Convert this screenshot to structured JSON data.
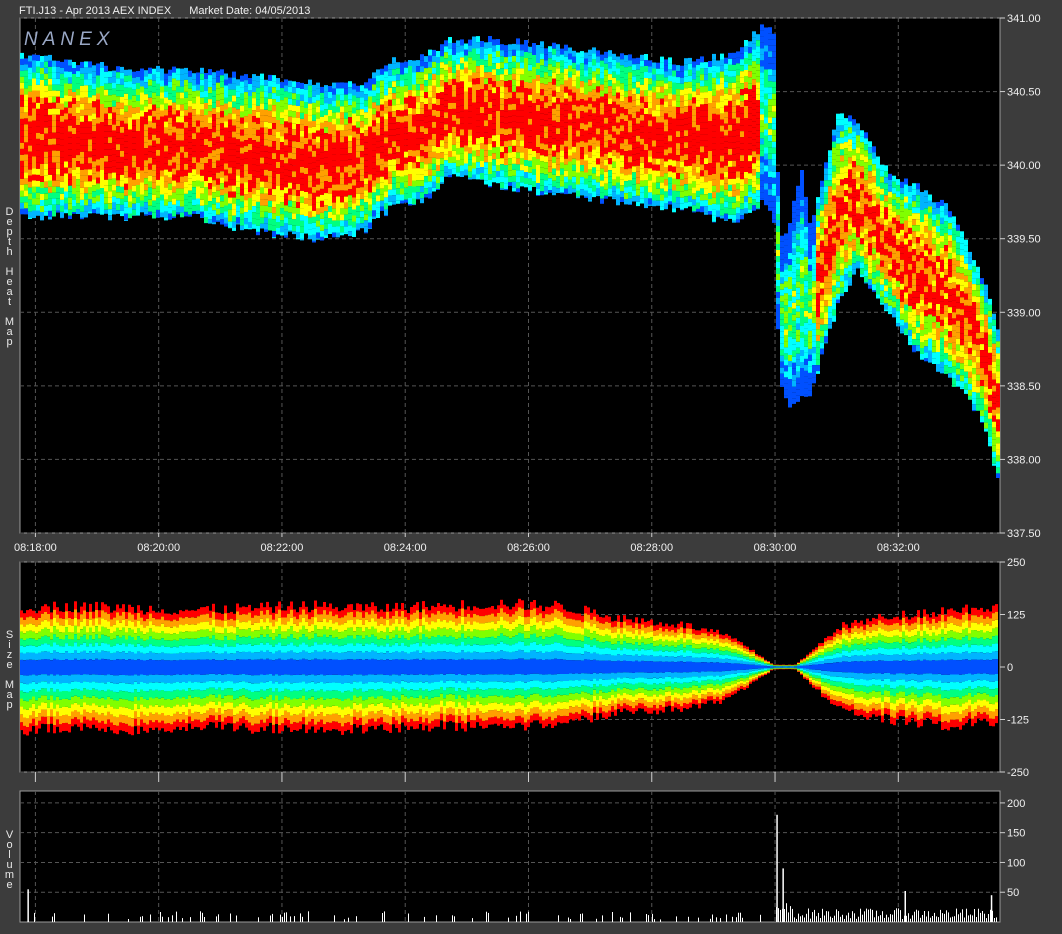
{
  "header": {
    "symbol_desc": "FTI.J13 - Apr 2013 AEX INDEX",
    "market_date_label": "Market Date: 04/05/2013"
  },
  "logo_text": "NANEX",
  "colors": {
    "background": "#3c3c3c",
    "plot_bg": "#000000",
    "grid": "#555555",
    "heat_scale": [
      "#0050ff",
      "#00b4ff",
      "#00ffff",
      "#00ff80",
      "#80ff00",
      "#ffff00",
      "#ffa000",
      "#ff0000"
    ],
    "volume_bar": "#ffffff"
  },
  "chart_data": [
    {
      "type": "heatmap",
      "name": "depth-heat-map",
      "panel_label": "Depth Heat Map",
      "x_ticks": [
        "08:18:00",
        "08:20:00",
        "08:22:00",
        "08:24:00",
        "08:26:00",
        "08:28:00",
        "08:30:00",
        "08:32:00"
      ],
      "y_ticks": [
        "341.00",
        "340.50",
        "340.00",
        "339.50",
        "339.00",
        "338.50",
        "338.00",
        "337.50"
      ],
      "ylim": [
        337.5,
        341.0
      ],
      "xlim_minutes": [
        17.75,
        33.65
      ],
      "grid": true,
      "bands": [
        {
          "t": 17.75,
          "low": 339.65,
          "high": 340.75
        },
        {
          "t": 18.5,
          "low": 339.65,
          "high": 340.7
        },
        {
          "t": 19.5,
          "low": 339.65,
          "high": 340.65
        },
        {
          "t": 20.5,
          "low": 339.65,
          "high": 340.65
        },
        {
          "t": 21.5,
          "low": 339.55,
          "high": 340.6
        },
        {
          "t": 22.5,
          "low": 339.5,
          "high": 340.55
        },
        {
          "t": 23.3,
          "low": 339.55,
          "high": 340.55
        },
        {
          "t": 23.7,
          "low": 339.7,
          "high": 340.7
        },
        {
          "t": 24.3,
          "low": 339.75,
          "high": 340.75
        },
        {
          "t": 24.7,
          "low": 339.95,
          "high": 340.85
        },
        {
          "t": 25.5,
          "low": 339.85,
          "high": 340.85
        },
        {
          "t": 26.5,
          "low": 339.8,
          "high": 340.8
        },
        {
          "t": 27.5,
          "low": 339.75,
          "high": 340.75
        },
        {
          "t": 28.5,
          "low": 339.7,
          "high": 340.7
        },
        {
          "t": 29.3,
          "low": 339.6,
          "high": 340.75
        },
        {
          "t": 29.8,
          "low": 339.75,
          "high": 340.95
        },
        {
          "t": 29.95,
          "low": 339.6,
          "high": 340.9
        },
        {
          "t": 30.05,
          "low": 338.5,
          "high": 339.5
        },
        {
          "t": 30.2,
          "low": 338.35,
          "high": 339.6
        },
        {
          "t": 30.4,
          "low": 338.45,
          "high": 339.95
        },
        {
          "t": 30.55,
          "low": 338.45,
          "high": 339.6
        },
        {
          "t": 31.0,
          "low": 339.05,
          "high": 340.35
        },
        {
          "t": 31.3,
          "low": 339.3,
          "high": 340.3
        },
        {
          "t": 31.8,
          "low": 339.0,
          "high": 339.95
        },
        {
          "t": 32.3,
          "low": 338.7,
          "high": 339.85
        },
        {
          "t": 32.8,
          "low": 338.55,
          "high": 339.7
        },
        {
          "t": 33.3,
          "low": 338.3,
          "high": 339.3
        },
        {
          "t": 33.6,
          "low": 337.85,
          "high": 338.85
        }
      ]
    },
    {
      "type": "area",
      "name": "size-map",
      "panel_label": "Size Map",
      "y_ticks": [
        "250",
        "125",
        "0",
        "-125",
        "-250"
      ],
      "ylim": [
        -250,
        250
      ],
      "envelope": [
        {
          "t": 17.75,
          "top": 140,
          "bottom": -150
        },
        {
          "t": 18.5,
          "top": 145,
          "bottom": -145
        },
        {
          "t": 19.5,
          "top": 140,
          "bottom": -150
        },
        {
          "t": 20.5,
          "top": 135,
          "bottom": -140
        },
        {
          "t": 21.5,
          "top": 140,
          "bottom": -145
        },
        {
          "t": 22.5,
          "top": 145,
          "bottom": -150
        },
        {
          "t": 23.5,
          "top": 140,
          "bottom": -145
        },
        {
          "t": 24.5,
          "top": 145,
          "bottom": -140
        },
        {
          "t": 25.5,
          "top": 150,
          "bottom": -140
        },
        {
          "t": 26.5,
          "top": 145,
          "bottom": -135
        },
        {
          "t": 27.0,
          "top": 130,
          "bottom": -120
        },
        {
          "t": 27.5,
          "top": 115,
          "bottom": -110
        },
        {
          "t": 28.5,
          "top": 100,
          "bottom": -100
        },
        {
          "t": 29.2,
          "top": 75,
          "bottom": -80
        },
        {
          "t": 29.6,
          "top": 40,
          "bottom": -40
        },
        {
          "t": 29.95,
          "top": 6,
          "bottom": -6
        },
        {
          "t": 30.3,
          "top": 5,
          "bottom": -5
        },
        {
          "t": 30.6,
          "top": 40,
          "bottom": -45
        },
        {
          "t": 31.0,
          "top": 95,
          "bottom": -100
        },
        {
          "t": 31.8,
          "top": 120,
          "bottom": -125
        },
        {
          "t": 32.8,
          "top": 135,
          "bottom": -140
        },
        {
          "t": 33.6,
          "top": 145,
          "bottom": -130
        }
      ]
    },
    {
      "type": "bar",
      "name": "volume",
      "panel_label": "Volume",
      "y_ticks": [
        "200",
        "150",
        "100",
        "50"
      ],
      "ylim": [
        0,
        220
      ],
      "spikes": [
        {
          "t": 17.87,
          "v": 55
        },
        {
          "t": 30.02,
          "v": 180
        },
        {
          "t": 30.12,
          "v": 90
        },
        {
          "t": 32.1,
          "v": 52
        },
        {
          "t": 33.5,
          "v": 45
        }
      ]
    }
  ]
}
